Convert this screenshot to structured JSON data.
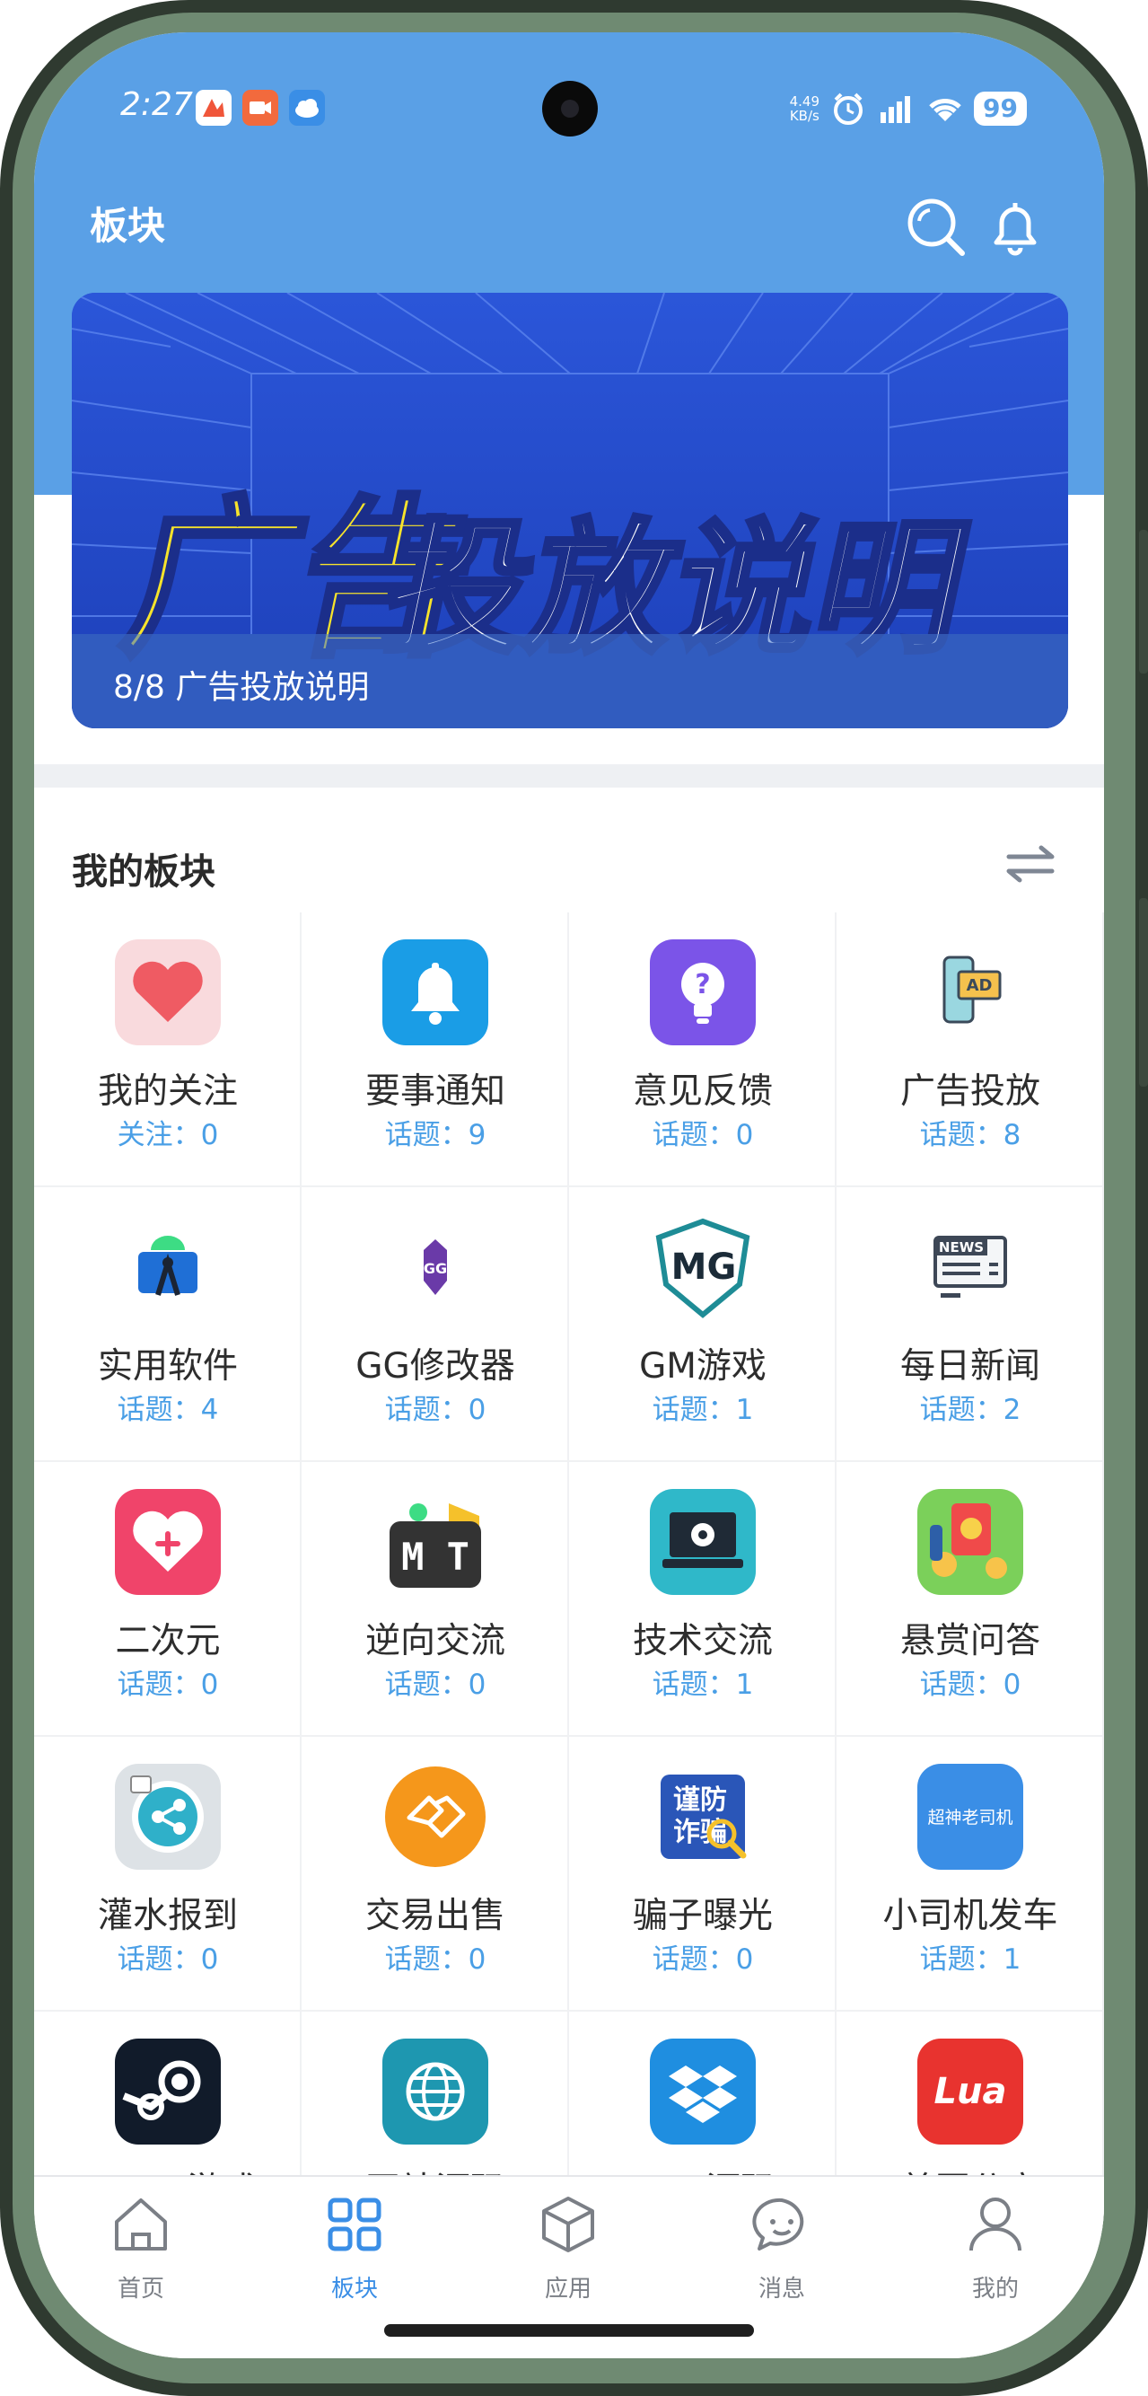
{
  "status_bar": {
    "time": "2:27",
    "net_speed_value": "4.49",
    "net_speed_unit": "KB/s",
    "battery": "99",
    "app_icons": [
      "huoshan-app-icon",
      "video-app-icon",
      "cloud-app-icon"
    ]
  },
  "header": {
    "title": "板块",
    "search_icon": "search-icon",
    "bell_icon": "bell-icon",
    "bg_color": "#5aa0e6"
  },
  "banner": {
    "graphic_text_yellow": "广告",
    "graphic_text_white": "投放说明",
    "caption": "8/8 广告投放说明"
  },
  "section": {
    "title": "我的板块",
    "switch_icon": "swap-arrows-icon"
  },
  "boards": [
    {
      "name": "我的关注",
      "stat": "关注：0",
      "icon": "heart-icon"
    },
    {
      "name": "要事通知",
      "stat": "话题：9",
      "icon": "bell-icon"
    },
    {
      "name": "意见反馈",
      "stat": "话题：0",
      "icon": "lightbulb-question-icon"
    },
    {
      "name": "广告投放",
      "stat": "话题：8",
      "icon": "ad-phone-icon"
    },
    {
      "name": "实用软件",
      "stat": "话题：4",
      "icon": "android-studio-icon"
    },
    {
      "name": "GG修改器",
      "stat": "话题：0",
      "icon": "gg-guardian-icon"
    },
    {
      "name": "GM游戏",
      "stat": "话题：1",
      "icon": "mg-shield-icon"
    },
    {
      "name": "每日新闻",
      "stat": "话题：2",
      "icon": "newspaper-icon"
    },
    {
      "name": "二次元",
      "stat": "话题：0",
      "icon": "heart-plus-icon"
    },
    {
      "name": "逆向交流",
      "stat": "话题：0",
      "icon": "mt-manager-icon"
    },
    {
      "name": "技术交流",
      "stat": "话题：1",
      "icon": "laptop-gear-icon"
    },
    {
      "name": "悬赏问答",
      "stat": "话题：0",
      "icon": "reward-icon"
    },
    {
      "name": "灌水报到",
      "stat": "话题：0",
      "icon": "share-icon"
    },
    {
      "name": "交易出售",
      "stat": "话题：0",
      "icon": "handshake-icon"
    },
    {
      "name": "骗子曝光",
      "stat": "话题：0",
      "icon": "anti-fraud-icon"
    },
    {
      "name": "小司机发车",
      "stat": "话题：1",
      "icon": "driver-icon"
    },
    {
      "name": "steam游戏",
      "stat": "",
      "icon": "steam-icon"
    },
    {
      "name": "网站源码",
      "stat": "",
      "icon": "globe-icon"
    },
    {
      "name": "iapp源码",
      "stat": "",
      "icon": "dropbox-icon"
    },
    {
      "name": "美图分享",
      "stat": "",
      "icon": "lua-icon"
    }
  ],
  "board_icon_text": {
    "ad": "AD",
    "news": "NEWS",
    "mg": "MG",
    "mt": "M T",
    "gg": "GG",
    "fraud": [
      "谨防",
      "诈骗"
    ],
    "driver": "超神老司机",
    "lua": "Lua"
  },
  "bottom_nav": {
    "items": [
      {
        "label": "首页",
        "icon": "home-icon",
        "active": false
      },
      {
        "label": "板块",
        "icon": "grid-icon",
        "active": true
      },
      {
        "label": "应用",
        "icon": "cube-icon",
        "active": false
      },
      {
        "label": "消息",
        "icon": "chat-bubble-icon",
        "active": false
      },
      {
        "label": "我的",
        "icon": "person-icon",
        "active": false
      }
    ]
  }
}
